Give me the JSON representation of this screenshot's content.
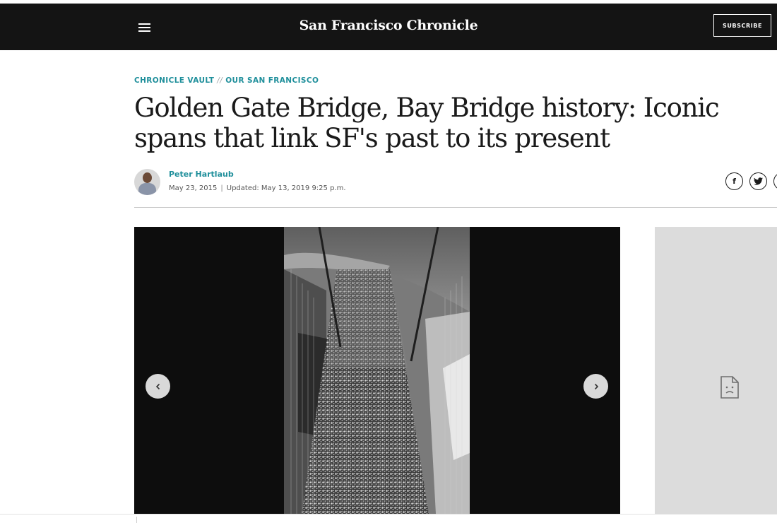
{
  "masthead": {
    "logo": "San Francisco Chronicle",
    "subscribe_label": "SUBSCRIBE",
    "background": "#141414"
  },
  "article": {
    "breadcrumb": [
      "CHRONICLE VAULT",
      "OUR SAN FRANCISCO"
    ],
    "breadcrumb_separator": "//",
    "headline": "Golden Gate Bridge, Bay Bridge history: Iconic spans that link SF's past to its present",
    "author": "Peter Hartlaub",
    "published": "May 23, 2015",
    "date_separator": "|",
    "updated": "Updated: May 13, 2019 9:25 p.m.",
    "accent_color": "#1f8f9b"
  },
  "share": {
    "icons": [
      "facebook-icon",
      "twitter-icon",
      "share-icon"
    ],
    "facebook_glyph": "f",
    "twitter_glyph": "t"
  },
  "gallery": {
    "prev_icon": "chevron-left-icon",
    "next_icon": "chevron-right-icon",
    "photo_description_icon": "bridge-crowd-photo"
  },
  "ad": {
    "icon": "broken-page-icon"
  }
}
